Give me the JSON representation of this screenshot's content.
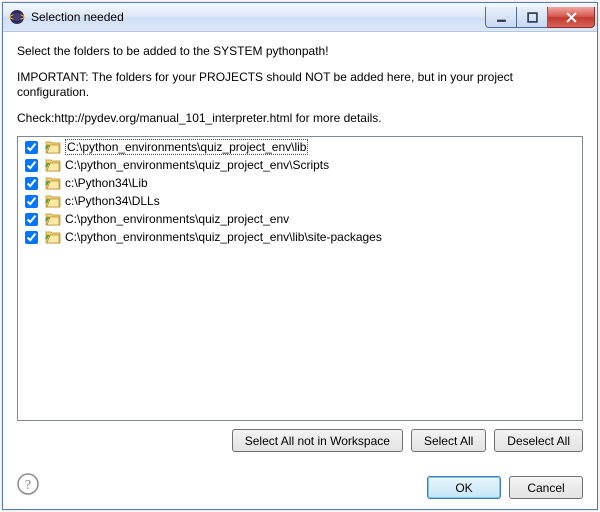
{
  "titlebar": {
    "title": "Selection needed"
  },
  "messages": {
    "line1": "Select the folders to be added to the SYSTEM pythonpath!",
    "line2": "IMPORTANT: The folders for your PROJECTS should NOT be added here, but in your project configuration.",
    "line3": "Check:http://pydev.org/manual_101_interpreter.html for more details."
  },
  "items": [
    {
      "checked": true,
      "path": "C:\\python_environments\\quiz_project_env\\lib",
      "selected": true
    },
    {
      "checked": true,
      "path": "C:\\python_environments\\quiz_project_env\\Scripts",
      "selected": false
    },
    {
      "checked": true,
      "path": "c:\\Python34\\Lib",
      "selected": false
    },
    {
      "checked": true,
      "path": "c:\\Python34\\DLLs",
      "selected": false
    },
    {
      "checked": true,
      "path": "C:\\python_environments\\quiz_project_env",
      "selected": false
    },
    {
      "checked": true,
      "path": "C:\\python_environments\\quiz_project_env\\lib\\site-packages",
      "selected": false
    }
  ],
  "buttons": {
    "select_not_ws": "Select All not in Workspace",
    "select_all": "Select All",
    "deselect_all": "Deselect All",
    "ok": "OK",
    "cancel": "Cancel"
  }
}
